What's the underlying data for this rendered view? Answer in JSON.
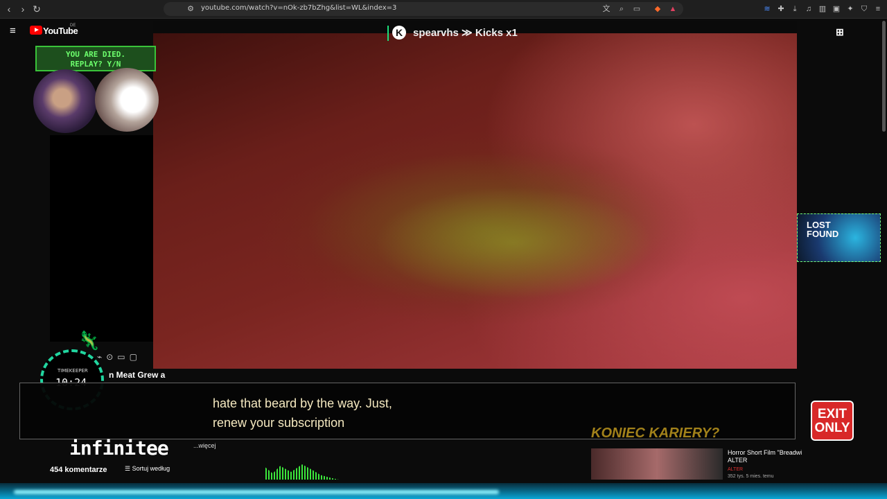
{
  "browser": {
    "url": "youtube.com/watch?v=nOk-zb7bZhg&list=WL&index=3"
  },
  "youtube": {
    "logo_text": "YouTube",
    "country": "DE"
  },
  "video": {
    "channel_badge": "K",
    "channel_text": "spearvhs ≫ Kicks x1",
    "title_partial": "n Meat Grew a",
    "caption_line1": "hate that beard by the way. Just,",
    "caption_line2": "renew your subscription"
  },
  "overlays": {
    "died_line1": "YOU ARE DIED.",
    "died_line2": "REPLAY? Y/N",
    "timekeeper_label": "TIMEKEEPER",
    "timekeeper_time": "10:24",
    "exit_line1": "EXIT",
    "exit_line2": "ONLY",
    "infinitee": "infinitee",
    "lost_found_line1": "LOST",
    "lost_found_line2": "FOUND"
  },
  "below": {
    "more_link": "...więcej",
    "comments_count": "454 komentarze",
    "sort_label": "Sortuj według"
  },
  "recommended": {
    "title": "Horror Short Film \"Breadwi",
    "channel_line": "ALTER",
    "channel": "ALTER",
    "meta": "352 tys.  5 mies. temu",
    "overlay_text": "KONIEC KARIERY?"
  },
  "colors": {
    "accent_red": "#ff0000",
    "overlay_green": "#3ac43a",
    "caption_color": "#f5e9c0",
    "exit_red": "#d82828"
  }
}
